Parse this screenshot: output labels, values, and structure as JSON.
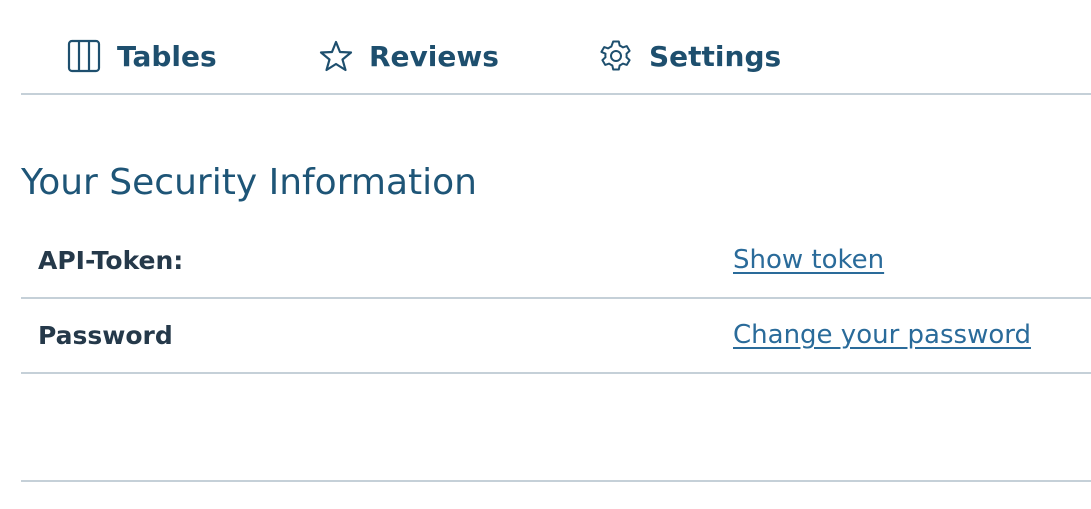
{
  "nav": {
    "items": [
      {
        "label": "Tables",
        "icon": "columns-icon"
      },
      {
        "label": "Reviews",
        "icon": "star-icon"
      },
      {
        "label": "Settings",
        "icon": "gear-icon"
      }
    ]
  },
  "security": {
    "title": "Your Security Information",
    "rows": [
      {
        "label": "API-Token:",
        "action": "Show token"
      },
      {
        "label": "Password",
        "action": "Change your password"
      }
    ]
  },
  "colors": {
    "nav_text": "#1e4f6e",
    "title_text": "#1e5577",
    "link": "#2a6b9a",
    "label_text": "#25394a",
    "divider": "#c5d0d8"
  }
}
